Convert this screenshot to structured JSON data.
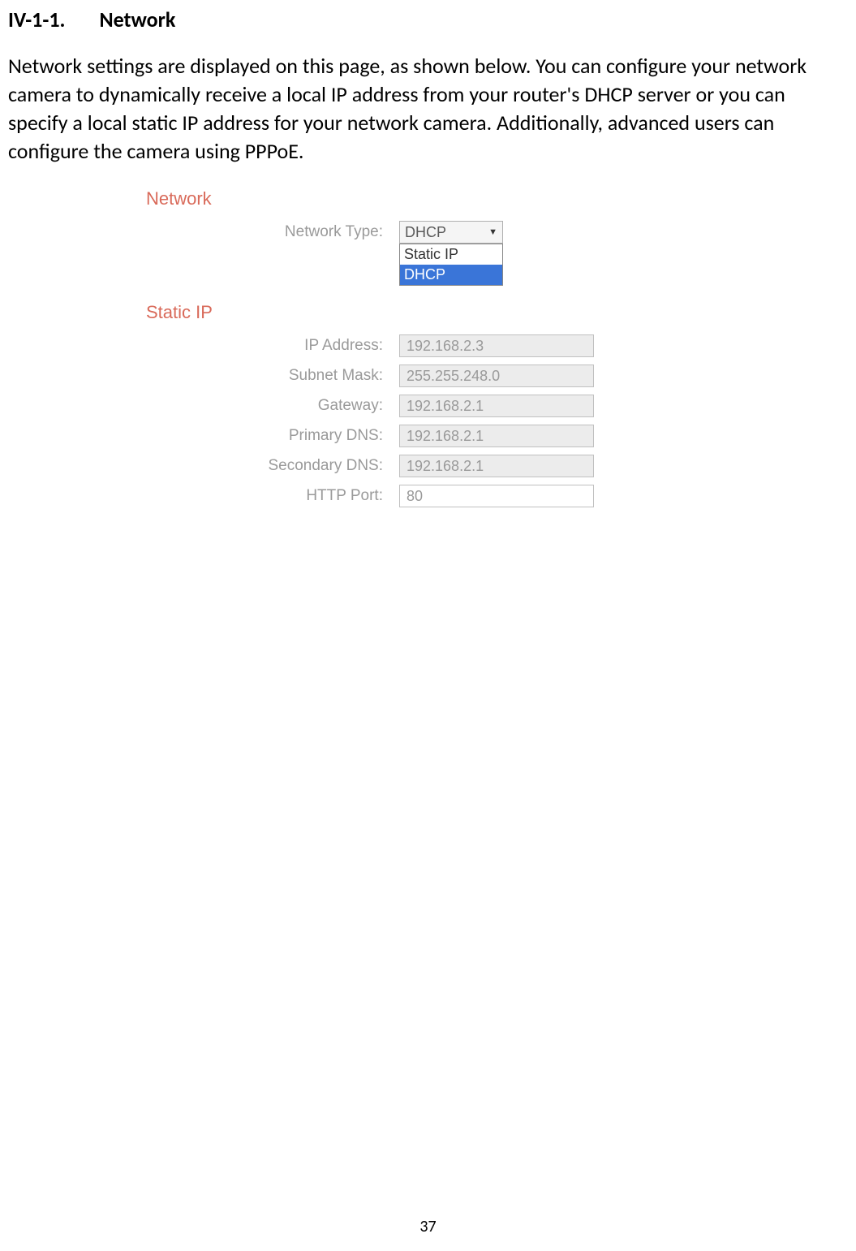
{
  "heading": {
    "number": "IV-1-1.",
    "title": "Network"
  },
  "paragraph": "Network settings are displayed on this page, as shown below. You can configure your network camera to dynamically receive a local IP address from your router's DHCP server or you can specify a local static IP address for your network camera. Additionally, advanced users can configure the camera using PPPoE.",
  "panel": {
    "network_title": "Network",
    "network_type_label": "Network Type:",
    "network_type_selected": "DHCP",
    "dropdown": {
      "option_static": "Static IP",
      "option_dhcp": "DHCP"
    },
    "static_ip_title": "Static IP",
    "fields": {
      "ip_address": {
        "label": "IP Address:",
        "value": "192.168.2.3"
      },
      "subnet_mask": {
        "label": "Subnet Mask:",
        "value": "255.255.248.0"
      },
      "gateway": {
        "label": "Gateway:",
        "value": "192.168.2.1"
      },
      "primary_dns": {
        "label": "Primary DNS:",
        "value": "192.168.2.1"
      },
      "secondary_dns": {
        "label": "Secondary DNS:",
        "value": "192.168.2.1"
      },
      "http_port": {
        "label": "HTTP Port:",
        "value": "80"
      }
    }
  },
  "page_number": "37"
}
